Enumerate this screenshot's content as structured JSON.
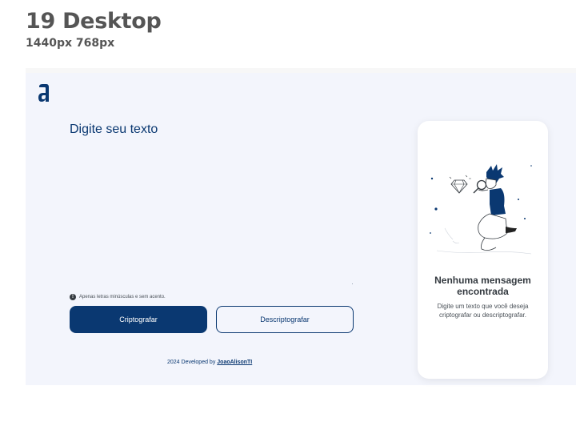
{
  "frame": {
    "title": "19 Desktop",
    "size": "1440px 768px"
  },
  "app": {
    "logo_icon": "alura-logo-icon",
    "input": {
      "placeholder": "Digite seu texto",
      "value": ""
    },
    "hint": {
      "icon": "exclamation-circle-icon",
      "text": "Apenas letras minúsculas e sem acento."
    },
    "buttons": {
      "encrypt_label": "Criptografar",
      "decrypt_label": "Descriptografar"
    },
    "footer": {
      "prefix": "2024 Developed by ",
      "link": "JoaoAlisonTI"
    },
    "output": {
      "illustration": "boy-with-magnifier-illustration",
      "title": "Nenhuma mensagem encontrada",
      "text": "Digite um texto que você deseja criptografar ou descriptografar."
    },
    "colors": {
      "primary": "#0a3871",
      "background": "#f3f5fc",
      "card": "#ffffff"
    }
  }
}
